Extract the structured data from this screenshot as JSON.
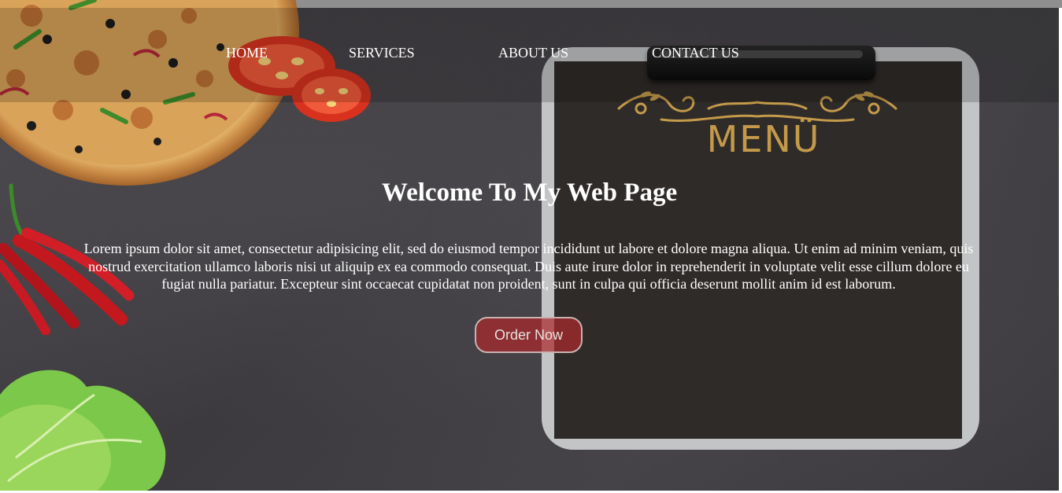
{
  "nav": {
    "home": "HOME",
    "services": "SERVICES",
    "about": "ABOUT US",
    "contact": "CONTACT US"
  },
  "hero": {
    "heading": "Welcome To My Web Page",
    "body": "Lorem ipsum dolor sit amet, consectetur adipisicing elit, sed do eiusmod tempor incididunt ut labore et dolore magna aliqua. Ut enim ad minim veniam, quis nostrud exercitation ullamco laboris nisi ut aliquip ex ea commodo consequat. Duis aute irure dolor in reprehenderit in voluptate velit esse cillum dolore eu fugiat nulla pariatur. Excepteur sint occaecat cupidatat non proident, sunt in culpa qui officia deserunt mollit anim id est laborum.",
    "cta_label": "Order Now"
  },
  "background": {
    "menu_board_text": "MENÜ",
    "icons": [
      "pizza-image",
      "tomato-image",
      "chili-pepper-image",
      "lettuce-image",
      "menu-clipboard-image"
    ]
  },
  "colors": {
    "background": "#3f3d41",
    "text": "#ffffff",
    "cta_fill": "#aa282c",
    "cta_border": "#c9b2b0",
    "menu_gold": "#c49a4a"
  }
}
